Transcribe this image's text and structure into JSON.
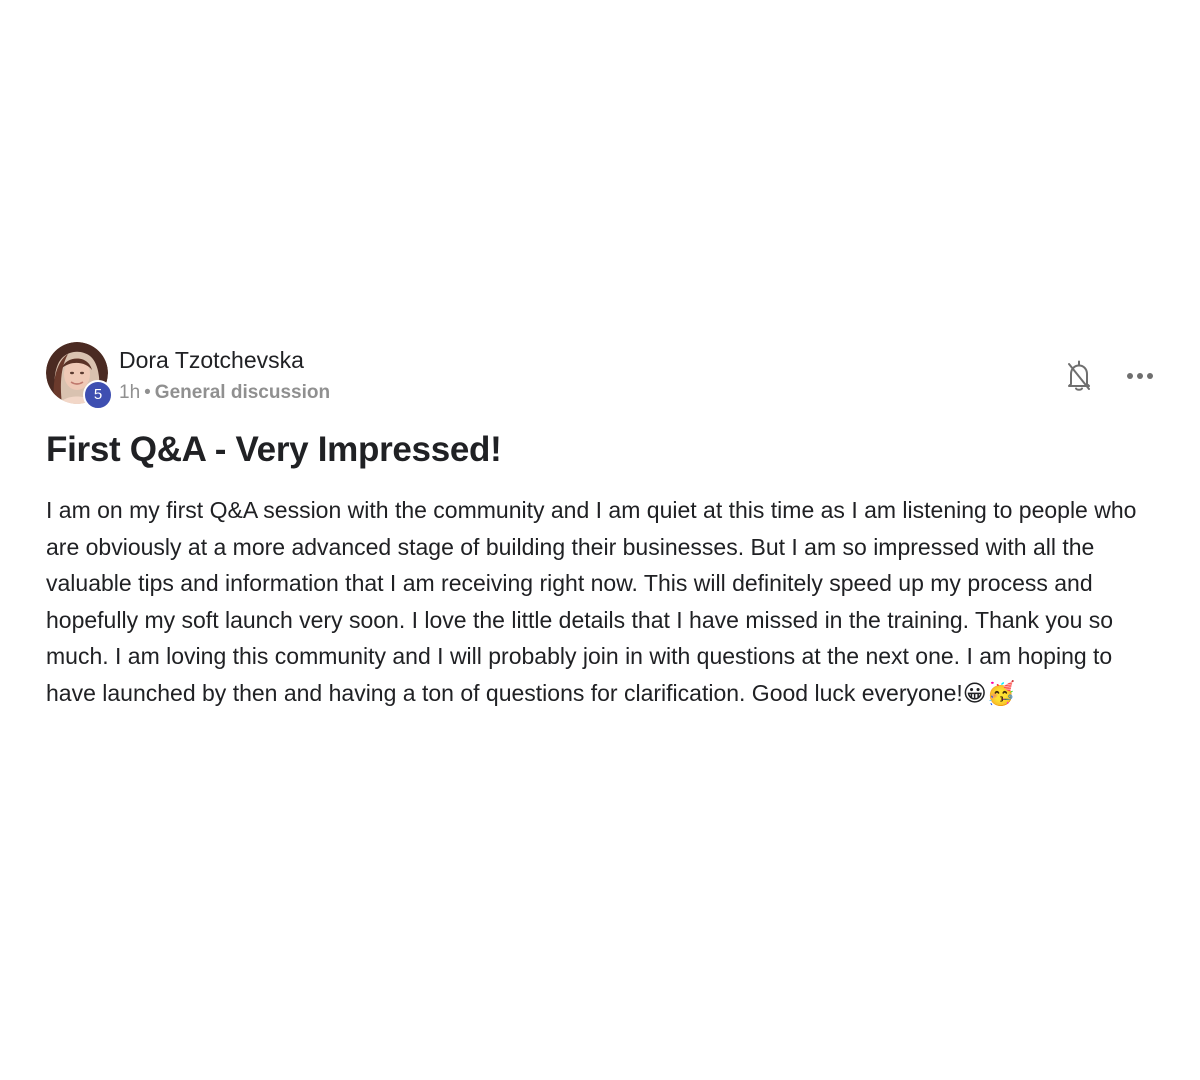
{
  "post": {
    "author": {
      "name": "Dora Tzotchevska",
      "level": "5",
      "avatar_icon": "user-avatar-photo"
    },
    "meta": {
      "time": "1h",
      "separator": "•",
      "category": "General discussion"
    },
    "actions": {
      "notify_icon": "bell-off-icon",
      "more_icon": "more-horizontal-icon"
    },
    "title": "First Q&A - Very Impressed!",
    "body": "I am on my first Q&A session with the community and I am quiet at this time as I am listening to people who are obviously at a more advanced stage of building their businesses. But I am so impressed with all the valuable tips and information that I am receiving right now. This will definitely speed up my process and hopefully my soft launch very soon. I love the little details that I have missed in the training. Thank you so much. I am loving this community and I will probably join in with questions at the next one. I am hoping to have launched by then and having a ton of questions for clarification. Good luck everyone!😀🥳"
  },
  "colors": {
    "badge": "#3e4fb1",
    "meta_text": "#909090",
    "text": "#202124"
  }
}
